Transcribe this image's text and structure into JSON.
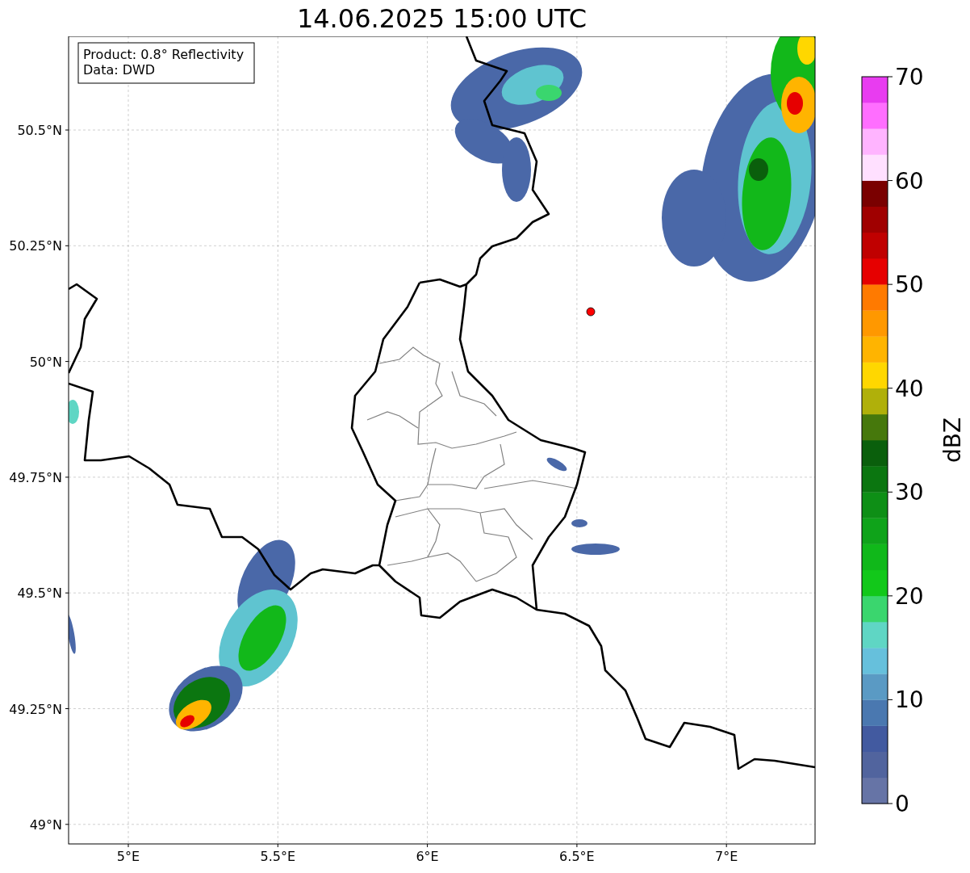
{
  "title": "14.06.2025 15:00 UTC",
  "info_box": {
    "lines": [
      "Product: 0.8° Reflectivity",
      "Data: DWD"
    ]
  },
  "map": {
    "x_ticks": [
      "5°E",
      "5.5°E",
      "6°E",
      "6.5°E",
      "7°E"
    ],
    "y_ticks": [
      "50.5°N",
      "50.25°N",
      "50°N",
      "49.75°N",
      "49.5°N",
      "49.25°N",
      "49°N"
    ]
  },
  "colorbar": {
    "label": "dBZ",
    "ticks": [
      "70",
      "60",
      "50",
      "40",
      "30",
      "20",
      "10",
      "0"
    ],
    "segments": [
      {
        "color": "#6674a6"
      },
      {
        "color": "#51649e"
      },
      {
        "color": "#425aa0"
      },
      {
        "color": "#4a78b0"
      },
      {
        "color": "#5a9ac4"
      },
      {
        "color": "#66c0dc"
      },
      {
        "color": "#5fd6c4"
      },
      {
        "color": "#3ad66e"
      },
      {
        "color": "#12c81a"
      },
      {
        "color": "#10b81a"
      },
      {
        "color": "#0fa31a"
      },
      {
        "color": "#0e8f16"
      },
      {
        "color": "#0b7610"
      },
      {
        "color": "#0a5f0c"
      },
      {
        "color": "#46780c"
      },
      {
        "color": "#b0b00a"
      },
      {
        "color": "#ffd700"
      },
      {
        "color": "#ffb400"
      },
      {
        "color": "#ff9800"
      },
      {
        "color": "#ff7a00"
      },
      {
        "color": "#e60000"
      },
      {
        "color": "#c00000"
      },
      {
        "color": "#a00000"
      },
      {
        "color": "#7a0000"
      },
      {
        "color": "#ffe0ff"
      },
      {
        "color": "#ffb4ff"
      },
      {
        "color": "#ff6eff"
      },
      {
        "color": "#e83cf0"
      }
    ]
  }
}
